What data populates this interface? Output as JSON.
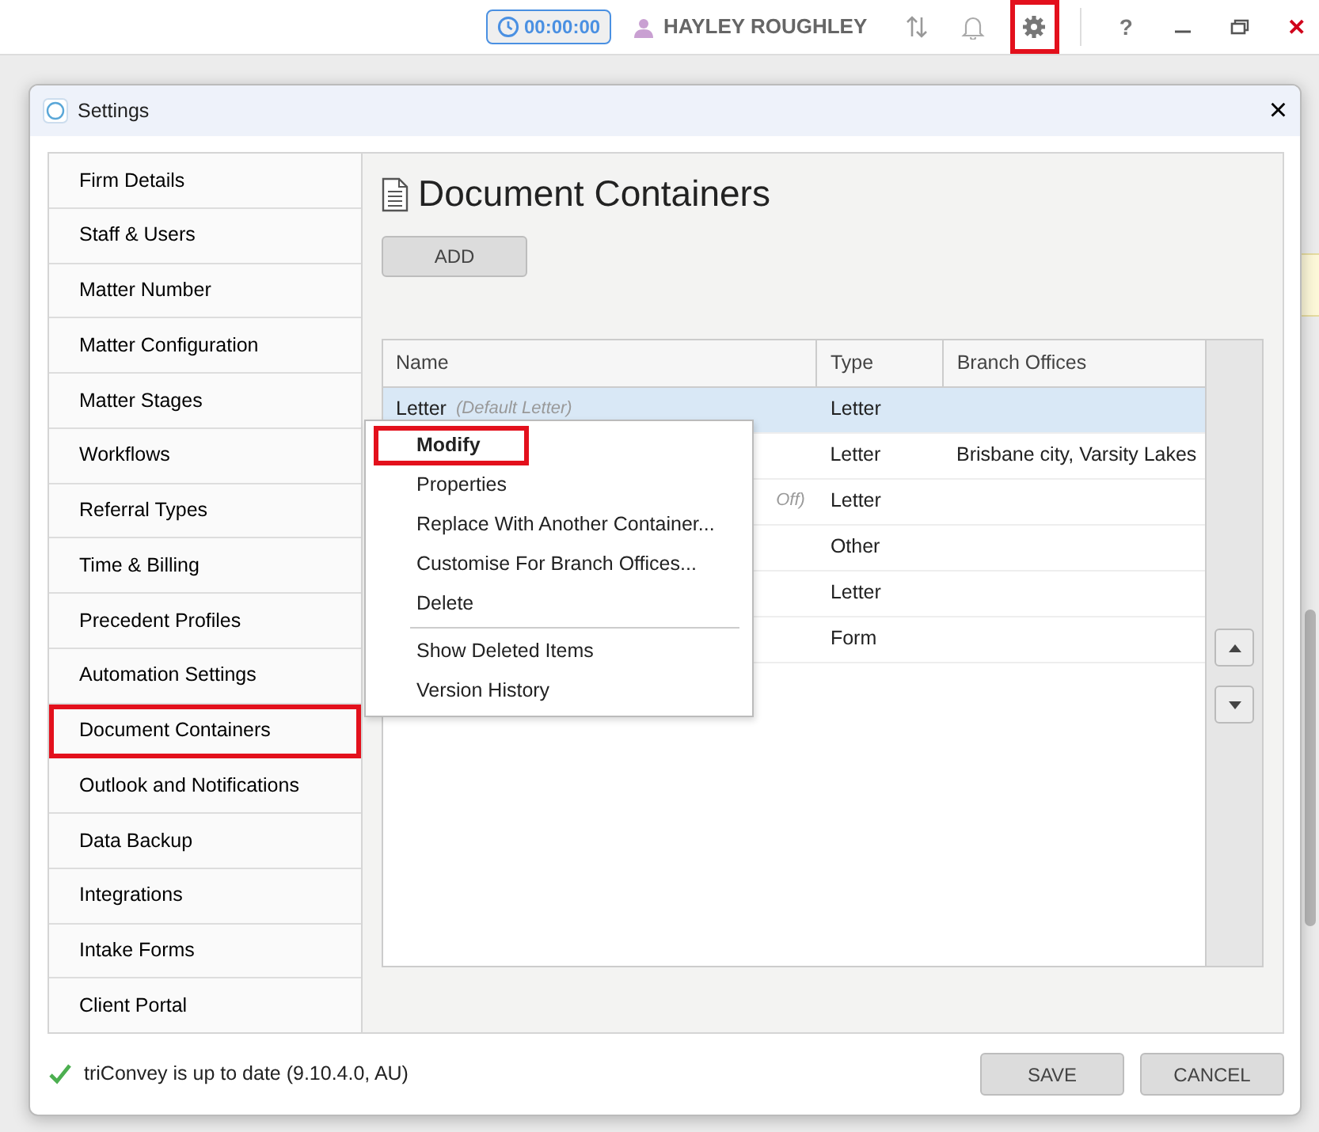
{
  "topbar": {
    "timer": "00:00:00",
    "user": "HAYLEY ROUGHLEY",
    "settings_highlighted": true,
    "help": "?",
    "close": "✕"
  },
  "dialog": {
    "title": "Settings",
    "close": "×"
  },
  "sidebar": {
    "items": [
      {
        "label": "Firm Details",
        "highlighted": false
      },
      {
        "label": "Staff & Users",
        "highlighted": false
      },
      {
        "label": "Matter Number",
        "highlighted": false
      },
      {
        "label": "Matter Configuration",
        "highlighted": false
      },
      {
        "label": "Matter Stages",
        "highlighted": false
      },
      {
        "label": "Workflows",
        "highlighted": false
      },
      {
        "label": "Referral Types",
        "highlighted": false
      },
      {
        "label": "Time & Billing",
        "highlighted": false
      },
      {
        "label": "Precedent Profiles",
        "highlighted": false
      },
      {
        "label": "Automation Settings",
        "highlighted": false
      },
      {
        "label": "Document Containers",
        "highlighted": true
      },
      {
        "label": "Outlook and Notifications",
        "highlighted": false
      },
      {
        "label": "Data Backup",
        "highlighted": false
      },
      {
        "label": "Integrations",
        "highlighted": false
      },
      {
        "label": "Intake Forms",
        "highlighted": false
      },
      {
        "label": "Client Portal",
        "highlighted": false
      }
    ]
  },
  "page": {
    "title": "Document Containers",
    "add_button": "ADD"
  },
  "table": {
    "columns": [
      "Name",
      "Type",
      "Branch Offices"
    ],
    "rows": [
      {
        "name": "Letter",
        "note": "(Default Letter)",
        "type": "Letter",
        "selected": true
      },
      {
        "type": "Letter",
        "branch_offices": "Brisbane city, Varsity Lakes",
        "selected": false
      },
      {
        "note": "Off)",
        "type": "Letter",
        "selected": false
      },
      {
        "type": "Other",
        "selected": false
      },
      {
        "type": "Letter",
        "selected": false
      },
      {
        "type": "Form",
        "selected": false
      }
    ]
  },
  "context_menu": {
    "items": [
      {
        "label": "Modify",
        "bold": true,
        "highlighted": true
      },
      {
        "label": "Properties",
        "bold": false,
        "highlighted": false
      },
      {
        "label": "Replace With Another Container...",
        "bold": false,
        "highlighted": false
      },
      {
        "label": "Customise For Branch Offices...",
        "bold": false,
        "highlighted": false
      },
      {
        "label": "Delete",
        "bold": false,
        "highlighted": false
      },
      {
        "kind": "separator"
      },
      {
        "label": "Show Deleted Items",
        "bold": false,
        "highlighted": false
      },
      {
        "label": "Version History",
        "bold": false,
        "highlighted": false
      }
    ]
  },
  "footer": {
    "status": "triConvey is up to date (9.10.4.0, AU)",
    "buttons": [
      "SAVE",
      "CANCEL"
    ]
  }
}
